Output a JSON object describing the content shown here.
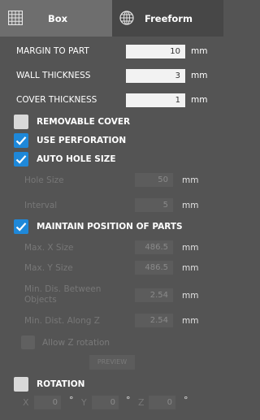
{
  "tabs": [
    {
      "label": "Box",
      "icon": "grid-icon",
      "active": true
    },
    {
      "label": "Freeform",
      "icon": "globe-mesh-icon",
      "active": false
    }
  ],
  "fields": {
    "margin_to_part": {
      "label": "MARGIN TO PART",
      "value": "10",
      "unit": "mm"
    },
    "wall_thickness": {
      "label": "WALL THICKNESS",
      "value": "3",
      "unit": "mm"
    },
    "cover_thickness": {
      "label": "COVER THICKNESS",
      "value": "1",
      "unit": "mm"
    }
  },
  "checks": {
    "removable_cover": {
      "label": "REMOVABLE COVER",
      "checked": false
    },
    "use_perforation": {
      "label": "USE PERFORATION",
      "checked": true
    },
    "auto_hole_size": {
      "label": "AUTO HOLE SIZE",
      "checked": true
    },
    "maintain_position": {
      "label": "MAINTAIN POSITION OF PARTS",
      "checked": true
    },
    "allow_z_rotation": {
      "label": "Allow Z rotation",
      "checked": false
    },
    "rotation": {
      "label": "ROTATION",
      "checked": false
    }
  },
  "perforation": {
    "hole_size": {
      "label": "Hole Size",
      "value": "50",
      "unit": "mm"
    },
    "interval": {
      "label": "Interval",
      "value": "5",
      "unit": "mm"
    }
  },
  "positions": {
    "max_x": {
      "label": "Max. X Size",
      "value": "486.5",
      "unit": "mm"
    },
    "max_y": {
      "label": "Max. Y Size",
      "value": "486.5",
      "unit": "mm"
    },
    "min_dis_objects": {
      "label_line1": "Min. Dis. Between",
      "label_line2": "Objects",
      "value": "2.54",
      "unit": "mm"
    },
    "min_dist_z": {
      "label": "Min. Dist. Along Z",
      "value": "2.54",
      "unit": "mm"
    }
  },
  "preview_label": "PREVIEW",
  "rotation_axes": [
    {
      "axis": "X",
      "value": "0",
      "unit": "°"
    },
    {
      "axis": "Y",
      "value": "0",
      "unit": "°"
    },
    {
      "axis": "Z",
      "value": "0",
      "unit": "°"
    }
  ],
  "colors": {
    "accent": "#1e88d9",
    "panel": "#545454",
    "active_tab": "#6e6e6e"
  }
}
